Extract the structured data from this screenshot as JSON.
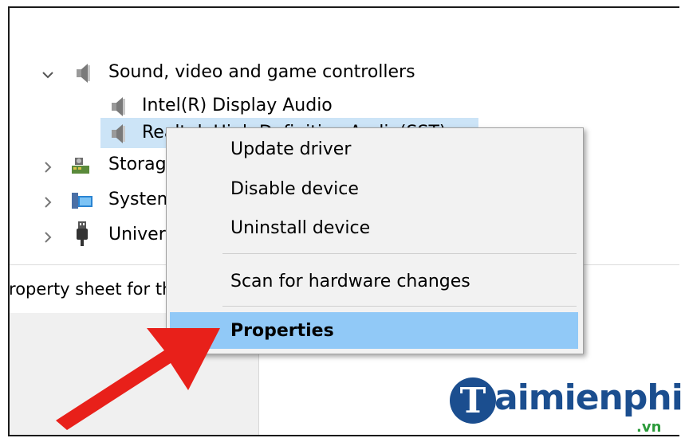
{
  "tree": {
    "category": "Sound, video and game controllers",
    "children": [
      "Intel(R) Display Audio",
      "Realtek High Definition Audio(SST)"
    ],
    "others": [
      "Storage controllers",
      "System devices",
      "Universal Serial Bus controllers"
    ]
  },
  "status": {
    "text": "Opens property sheet for the current selection."
  },
  "context_menu": {
    "items": [
      "Update driver",
      "Disable device",
      "Uninstall device",
      "Scan for hardware changes",
      "Properties"
    ]
  },
  "watermark": {
    "initial": "T",
    "brand": "aimienphi",
    "domain": ".vn"
  },
  "colors": {
    "selection": "#cce4f7",
    "menu_highlight": "#91c9f7",
    "arrow": "#e8201a",
    "brand": "#1b4e8f"
  }
}
